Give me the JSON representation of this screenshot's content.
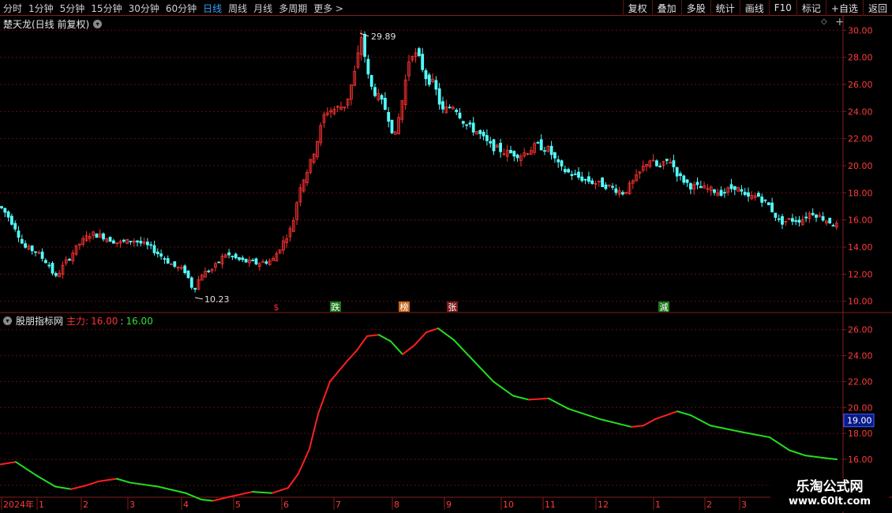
{
  "toolbar": {
    "periods": [
      "分时",
      "1分钟",
      "5分钟",
      "15分钟",
      "30分钟",
      "60分钟",
      "日线",
      "周线",
      "月线",
      "多周期",
      "更多 >"
    ],
    "active_period": "日线",
    "tools": [
      "复权",
      "叠加",
      "多股",
      "统计",
      "画线",
      "F10",
      "标记",
      "+自选",
      "返回"
    ]
  },
  "main_panel": {
    "title": "楚天龙(日线 前复权)",
    "y_ticks": [
      "30.00",
      "28.00",
      "26.00",
      "24.00",
      "22.00",
      "20.00",
      "18.00",
      "16.00",
      "14.00",
      "12.00",
      "10.00"
    ],
    "high_label": "29.89",
    "low_label": "10.23",
    "markers": [
      {
        "text": "$",
        "color": "#ff3030",
        "bg": "#000000"
      },
      {
        "text": "跌",
        "color": "#ffffff",
        "bg": "#1c7a1c"
      },
      {
        "text": "榜",
        "color": "#ffffff",
        "bg": "#c86a1c"
      },
      {
        "text": "张",
        "color": "#ffffff",
        "bg": "#7a1c1c"
      },
      {
        "text": "減",
        "color": "#ffffff",
        "bg": "#1c7a1c"
      }
    ]
  },
  "indicator_panel": {
    "title": "股朋指标网",
    "series_label": "主力:",
    "value_red": "16.00",
    "value_green": "16.00",
    "y_ticks": [
      "26.00",
      "24.00",
      "22.00",
      "20.00",
      "18.00",
      "16.00",
      "14.00"
    ],
    "cursor_value": "19.00"
  },
  "x_axis": {
    "labels": [
      "2024年",
      "1",
      "2",
      "3",
      "4",
      "5",
      "6",
      "7",
      "8",
      "9",
      "10",
      "11",
      "12",
      "1",
      "2",
      "3"
    ]
  },
  "watermark": {
    "line1": "乐淘公式网",
    "line2": "www.60lt.com"
  },
  "colors": {
    "up": "#ff3232",
    "down": "#54fcfc",
    "rise": "#ff2020",
    "fall": "#20e020",
    "grid": "#5a1010",
    "axis": "#8a1c1c"
  },
  "chart_data": {
    "type": "candlestick+line",
    "main_ylim": [
      10,
      30
    ],
    "indicator_ylim": [
      14,
      26
    ],
    "indicator_series": [
      [
        0,
        15.6
      ],
      [
        20,
        15.8
      ],
      [
        45,
        14.8
      ],
      [
        70,
        13.9
      ],
      [
        90,
        13.7
      ],
      [
        110,
        14.0
      ],
      [
        125,
        14.3
      ],
      [
        148,
        14.5
      ],
      [
        165,
        14.2
      ],
      [
        200,
        13.9
      ],
      [
        235,
        13.4
      ],
      [
        255,
        12.9
      ],
      [
        270,
        12.8
      ],
      [
        290,
        13.1
      ],
      [
        320,
        13.5
      ],
      [
        345,
        13.4
      ],
      [
        365,
        13.8
      ],
      [
        378,
        14.9
      ],
      [
        392,
        16.8
      ],
      [
        403,
        19.5
      ],
      [
        418,
        22.0
      ],
      [
        440,
        23.6
      ],
      [
        452,
        24.4
      ],
      [
        465,
        25.5
      ],
      [
        480,
        25.6
      ],
      [
        495,
        25.1
      ],
      [
        510,
        24.1
      ],
      [
        525,
        24.8
      ],
      [
        540,
        25.8
      ],
      [
        555,
        26.1
      ],
      [
        575,
        25.2
      ],
      [
        600,
        23.6
      ],
      [
        625,
        22.0
      ],
      [
        650,
        20.9
      ],
      [
        670,
        20.6
      ],
      [
        695,
        20.7
      ],
      [
        720,
        19.9
      ],
      [
        760,
        19.1
      ],
      [
        800,
        18.5
      ],
      [
        815,
        18.6
      ],
      [
        830,
        19.1
      ],
      [
        858,
        19.7
      ],
      [
        875,
        19.4
      ],
      [
        900,
        18.6
      ],
      [
        940,
        18.1
      ],
      [
        975,
        17.7
      ],
      [
        1000,
        16.7
      ],
      [
        1020,
        16.3
      ],
      [
        1045,
        16.1
      ],
      [
        1060,
        16.0
      ]
    ],
    "candle_path": [
      [
        0,
        17.0
      ],
      [
        10,
        16.3
      ],
      [
        20,
        15.4
      ],
      [
        30,
        14.0
      ],
      [
        45,
        13.7
      ],
      [
        62,
        12.7
      ],
      [
        70,
        11.7
      ],
      [
        82,
        12.8
      ],
      [
        100,
        14.2
      ],
      [
        115,
        15.0
      ],
      [
        130,
        14.8
      ],
      [
        150,
        14.3
      ],
      [
        170,
        14.5
      ],
      [
        190,
        14.0
      ],
      [
        205,
        13.3
      ],
      [
        220,
        12.6
      ],
      [
        235,
        12.2
      ],
      [
        245,
        10.8
      ],
      [
        255,
        12.0
      ],
      [
        270,
        12.4
      ],
      [
        285,
        13.5
      ],
      [
        305,
        13.0
      ],
      [
        325,
        12.8
      ],
      [
        345,
        13.0
      ],
      [
        355,
        14.0
      ],
      [
        370,
        15.5
      ],
      [
        380,
        18.5
      ],
      [
        392,
        20.0
      ],
      [
        400,
        21.5
      ],
      [
        412,
        24.0
      ],
      [
        425,
        24.2
      ],
      [
        438,
        24.5
      ],
      [
        450,
        27.0
      ],
      [
        458,
        29.6
      ],
      [
        468,
        26.0
      ],
      [
        480,
        25.0
      ],
      [
        490,
        24.0
      ],
      [
        500,
        22.0
      ],
      [
        510,
        25.0
      ],
      [
        520,
        28.5
      ],
      [
        530,
        28.0
      ],
      [
        540,
        26.5
      ],
      [
        550,
        26.0
      ],
      [
        560,
        24.0
      ],
      [
        575,
        24.5
      ],
      [
        590,
        23.0
      ],
      [
        605,
        22.5
      ],
      [
        620,
        21.5
      ],
      [
        640,
        21.0
      ],
      [
        660,
        20.8
      ],
      [
        680,
        21.5
      ],
      [
        695,
        21.2
      ],
      [
        710,
        19.8
      ],
      [
        730,
        19.2
      ],
      [
        750,
        18.8
      ],
      [
        770,
        18.5
      ],
      [
        790,
        18.0
      ],
      [
        805,
        19.0
      ],
      [
        822,
        20.5
      ],
      [
        835,
        19.8
      ],
      [
        848,
        20.5
      ],
      [
        860,
        19.2
      ],
      [
        875,
        18.5
      ],
      [
        895,
        18.3
      ],
      [
        915,
        18.0
      ],
      [
        932,
        18.5
      ],
      [
        945,
        17.6
      ],
      [
        960,
        17.8
      ],
      [
        975,
        17.0
      ],
      [
        988,
        15.8
      ],
      [
        1000,
        16.0
      ],
      [
        1015,
        16.0
      ],
      [
        1028,
        16.6
      ],
      [
        1040,
        16.2
      ],
      [
        1060,
        15.6
      ]
    ]
  }
}
